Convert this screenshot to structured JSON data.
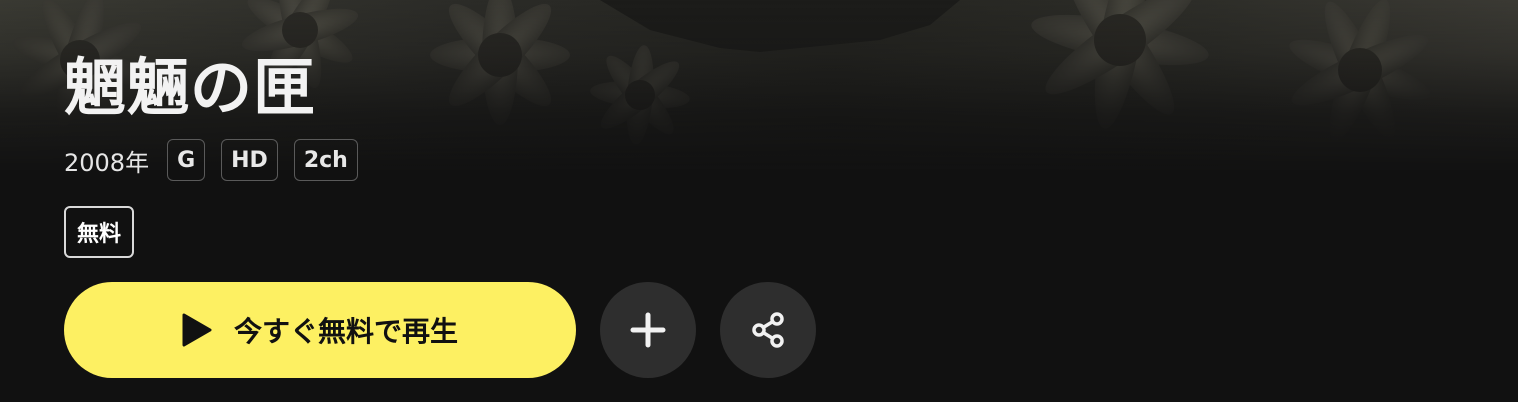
{
  "title": "魍魎の匣",
  "meta": {
    "year": "2008年",
    "badges": [
      "G",
      "HD",
      "2ch"
    ]
  },
  "free_tag": "無料",
  "actions": {
    "play_label": "今すぐ無料で再生",
    "play_icon": "play-icon",
    "add_icon": "plus-icon",
    "share_icon": "share-icon"
  },
  "colors": {
    "background": "#111111",
    "play_button": "#fdf062",
    "circle_button": "#2e2e2e"
  }
}
